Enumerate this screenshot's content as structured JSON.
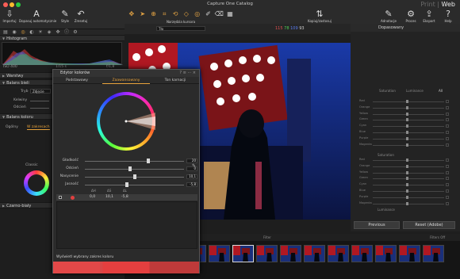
{
  "app": {
    "title": "Capture One Catalog"
  },
  "toolbar": {
    "import": "Importuj",
    "auto_adjust": "Dopasuj automatycznie",
    "style": "Style",
    "undo": "Zresetuj",
    "cursor_tools": "Narzędzia kursora",
    "copy_apply": "Kopiuj/zastosuj",
    "annotations": "Adnotacje",
    "process": "Proces",
    "export": "Eksport",
    "help": "Help"
  },
  "modes": {
    "print": "Print",
    "web": "Web",
    "separator": "|"
  },
  "left": {
    "histogram_title": "Histogram",
    "iso": "ISO 400",
    "shutter": "1/15 s",
    "aperture": "f/1,8",
    "warstwy": "Warstwy",
    "white_balance": "Balans bieli",
    "wb_mode_label": "Tryb",
    "wb_mode_value": "Zdjęcie",
    "kelvin_label": "Kelwiny",
    "tint_label": "Odcień",
    "color_balance": "Balans koloru",
    "cb_tab1": "Ogólny",
    "cb_tab2": "W zakresach",
    "classic": "Classic",
    "bw": "Czarno-biały"
  },
  "viewer": {
    "layer": "Tło",
    "readout_r": "115",
    "readout_g": "78",
    "readout_b": "109",
    "readout_l": "93"
  },
  "editor": {
    "title": "Edytor kolorów",
    "tab_basic": "Podstawowy",
    "tab_advanced": "Zaawansowany",
    "tab_skin": "Ton karnacji",
    "rows": [
      {
        "label": "Gładkość",
        "value": "20",
        "pos": 0.62
      },
      {
        "label": "Odcień",
        "value": "0",
        "pos": 0.44
      },
      {
        "label": "Nasycenie",
        "value": "10,1",
        "pos": 0.49
      },
      {
        "label": "Jasność",
        "value": "-5,8",
        "pos": 0.41
      }
    ],
    "delta_h": "ΔH",
    "delta_s": "ΔS",
    "delta_l": "ΔL",
    "delta_values": [
      "0,0",
      "10,1",
      "-5,8"
    ],
    "show_range": "Wyświetl wybrany zakres koloru"
  },
  "right": {
    "preset": "Dopasowany",
    "tab_sat": "Saturation",
    "tab_lum": "Luminance",
    "tab_all": "All",
    "groups": [
      "Saturation",
      "Luminance"
    ],
    "colors": [
      "Red",
      "Orange",
      "Yellow",
      "Green",
      "Cyan",
      "Blue",
      "Purple",
      "Magenta"
    ],
    "previous": "Previous",
    "reset": "Reset (Adobe)"
  },
  "filmstrip": {
    "filter_label": "Filter",
    "file": "_ML_12517.NEF",
    "filters_off": "Filters Off"
  }
}
